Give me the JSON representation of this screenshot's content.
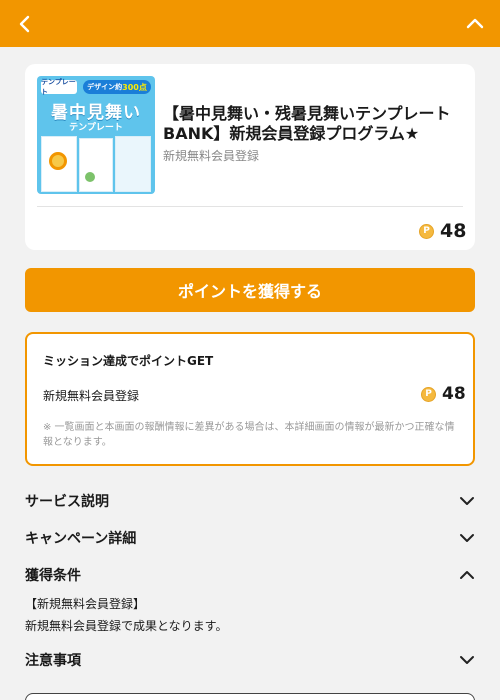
{
  "header": {
    "back_icon": "chevron-left-icon",
    "collapse_icon": "chevron-up-icon",
    "color": "#f29600"
  },
  "offer": {
    "thumbnail": {
      "logo_text": "テンプレート",
      "pill_text": "デザイン約",
      "pill_count": "300点",
      "title": "暑中見舞い",
      "subtitle": "テンプレート"
    },
    "title": "【暑中見舞い・残暑見舞いテンプレートBANK】新規会員登録プログラム★",
    "subtitle": "新規無料会員登録",
    "coin_symbol": "P",
    "points": "48"
  },
  "cta": {
    "label": "ポイントを獲得する"
  },
  "mission": {
    "title": "ミッション達成でポイントGET",
    "item_label": "新規無料会員登録",
    "coin_symbol": "P",
    "item_points": "48",
    "note": "※ 一覧画面と本画面の報酬情報に差異がある場合は、本詳細画面の情報が最新かつ正確な情報となります。"
  },
  "sections": {
    "service": {
      "label": "サービス説明",
      "state": "collapsed"
    },
    "campaign": {
      "label": "キャンペーン詳細",
      "state": "collapsed"
    },
    "conditions": {
      "label": "獲得条件",
      "state": "expanded",
      "heading": "【新規無料会員登録】",
      "body": "新規無料会員登録で成果となります。"
    },
    "notes": {
      "label": "注意事項",
      "state": "collapsed"
    }
  }
}
